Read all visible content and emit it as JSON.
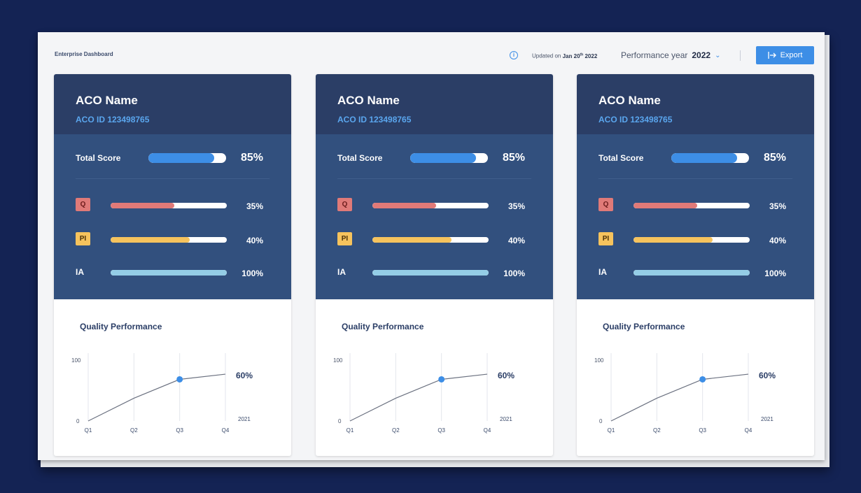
{
  "app": {
    "title": "Enterprise Dashboard",
    "updated_prefix": "Updated on",
    "updated_date": "Jan 20",
    "updated_sup": "th",
    "updated_year": "2022",
    "performance_label": "Performance year",
    "performance_year": "2022",
    "export_label": "Export"
  },
  "colors": {
    "accent": "#3d8ee6",
    "header": "#2b3e66",
    "scores_bg": "#32507e",
    "q": "#e07a78",
    "pi": "#f6c35d",
    "ia": "#94cde6"
  },
  "cards": [
    {
      "name": "ACO Name",
      "id": "ACO ID 123498765",
      "total_label": "Total Score",
      "total_pct": "85%",
      "total_value": 0.85,
      "metrics": [
        {
          "label": "Q",
          "pct": "35%",
          "value": 0.55
        },
        {
          "label": "PI",
          "pct": "40%",
          "value": 0.68
        },
        {
          "label": "IA",
          "pct": "100%",
          "value": 1.0
        }
      ],
      "chart_title": "Quality Performance"
    },
    {
      "name": "ACO Name",
      "id": "ACO ID 123498765",
      "total_label": "Total Score",
      "total_pct": "85%",
      "total_value": 0.85,
      "metrics": [
        {
          "label": "Q",
          "pct": "35%",
          "value": 0.55
        },
        {
          "label": "PI",
          "pct": "40%",
          "value": 0.68
        },
        {
          "label": "IA",
          "pct": "100%",
          "value": 1.0
        }
      ],
      "chart_title": "Quality Performance"
    },
    {
      "name": "ACO Name",
      "id": "ACO ID 123498765",
      "total_label": "Total Score",
      "total_pct": "85%",
      "total_value": 0.85,
      "metrics": [
        {
          "label": "Q",
          "pct": "35%",
          "value": 0.55
        },
        {
          "label": "PI",
          "pct": "40%",
          "value": 0.68
        },
        {
          "label": "IA",
          "pct": "100%",
          "value": 1.0
        }
      ],
      "chart_title": "Quality Performance"
    }
  ],
  "chart_data": {
    "type": "line",
    "title": "Quality Performance",
    "categories": [
      "Q1",
      "Q2",
      "Q3",
      "Q4"
    ],
    "values": [
      0,
      35,
      64,
      72
    ],
    "ylim": [
      0,
      100
    ],
    "yticks": [
      "0",
      "100"
    ],
    "highlight_index": 2,
    "end_label": "60%",
    "year_label": "2021"
  }
}
